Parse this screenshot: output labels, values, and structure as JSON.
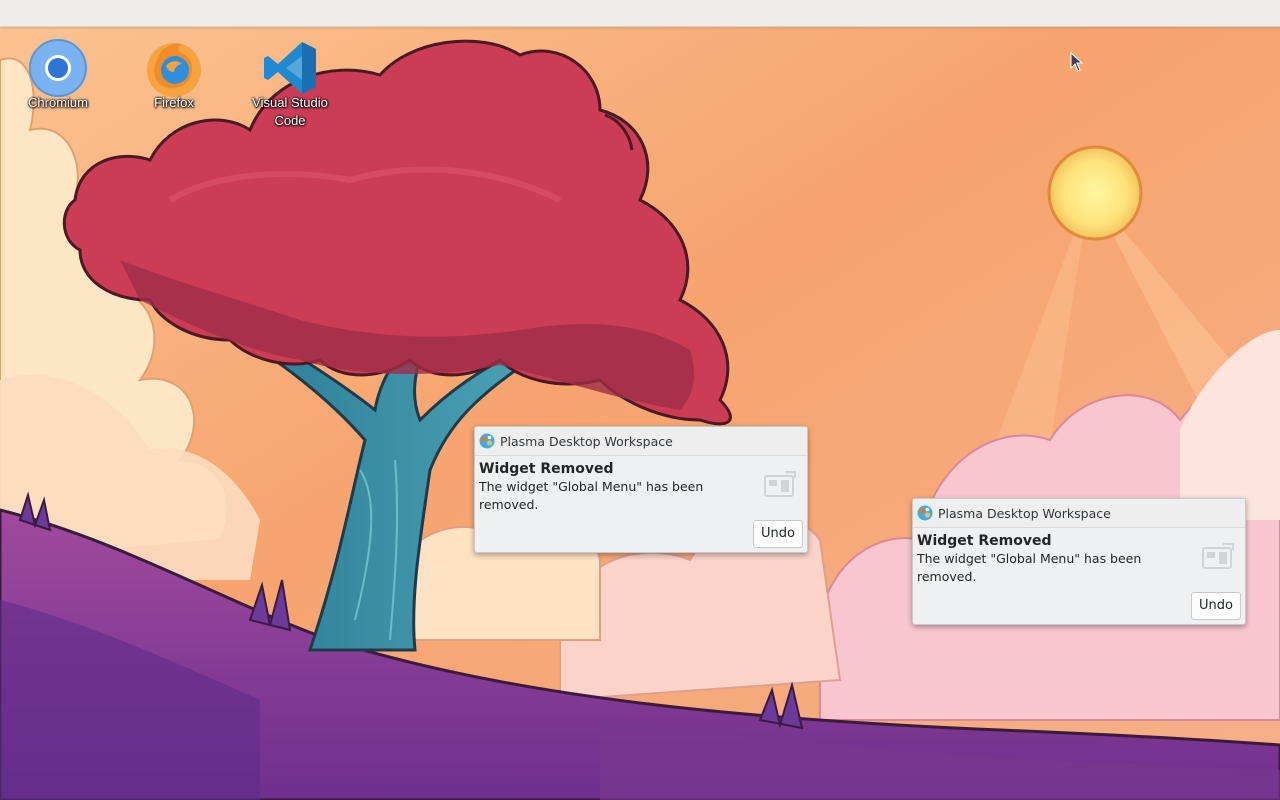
{
  "desktop": {
    "icons": [
      {
        "label": "Chromium",
        "icon": "chromium-icon"
      },
      {
        "label": "Firefox",
        "icon": "firefox-icon"
      },
      {
        "label": "Visual Studio Code",
        "icon": "vscode-icon"
      }
    ]
  },
  "notifications": [
    {
      "app_name": "Plasma Desktop Workspace",
      "title": "Widget Removed",
      "body": "The widget \"Global Menu\" has been removed.",
      "action_label": "Undo"
    },
    {
      "app_name": "Plasma Desktop Workspace",
      "title": "Widget Removed",
      "body": "The widget \"Global Menu\" has been removed.",
      "action_label": "Undo"
    }
  ],
  "colors": {
    "panel": "#efece9",
    "sky_top": "#fbd0a0",
    "sky_mid": "#f6a06a",
    "tree_foliage": "#c93a52",
    "tree_trunk": "#3b8fa5",
    "ground": "#8a3fa0",
    "sun": "#fbe070"
  }
}
